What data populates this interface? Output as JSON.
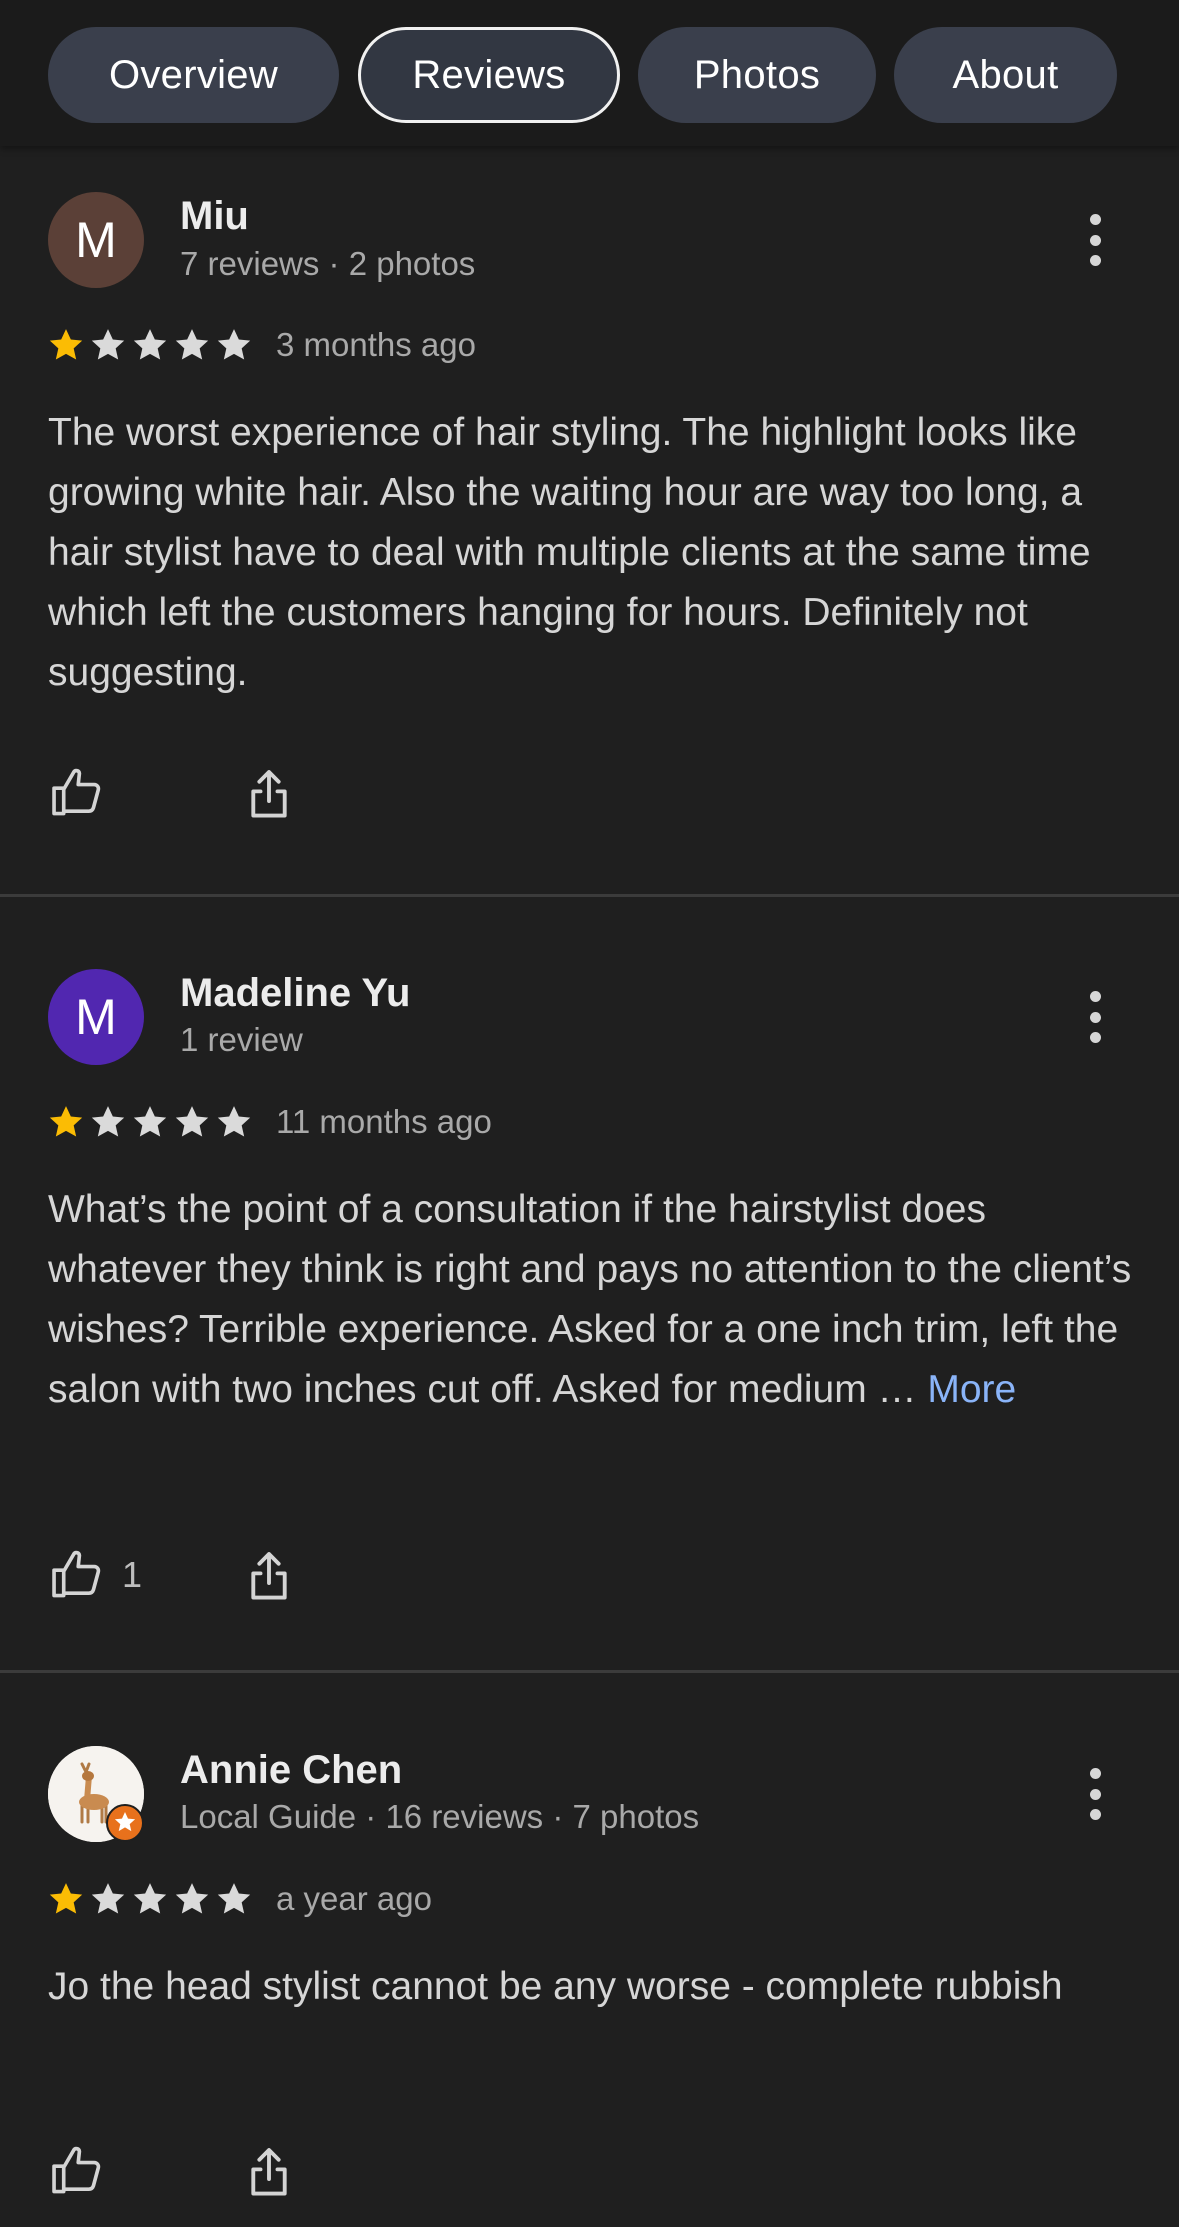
{
  "tabs": [
    {
      "label": "Overview",
      "active": false
    },
    {
      "label": "Reviews",
      "active": true
    },
    {
      "label": "Photos",
      "active": false
    },
    {
      "label": "About",
      "active": false
    }
  ],
  "colors": {
    "star_filled": "#fbbc04",
    "star_empty": "#dadada",
    "link": "#8ab4f8",
    "avatar_miu": "#5b4037",
    "avatar_madeline": "#5127b0",
    "local_guide_badge": "#e8711c"
  },
  "reviews": [
    {
      "avatar_letter": "M",
      "name": "Miu",
      "meta": "7 reviews · 2 photos",
      "rating": 1,
      "max_rating": 5,
      "time": "3 months ago",
      "text": "The worst experience of hair styling. The highlight looks like growing white hair. Also the waiting hour are way too long, a hair stylist have to deal with multiple clients at the same time which left the customers hanging for hours. Definitely not suggesting.",
      "more": "",
      "likes": ""
    },
    {
      "avatar_letter": "M",
      "name": "Madeline Yu",
      "meta": "1 review",
      "rating": 1,
      "max_rating": 5,
      "time": "11 months ago",
      "text": "What’s the point of a consultation if the hairstylist does whatever they think is right and pays no attention to the client’s wishes? Terrible experience. Asked for a one inch trim, left the salon with two inches cut off. Asked for medium …",
      "more": "More",
      "likes": "1"
    },
    {
      "avatar_letter": "",
      "name": "Annie Chen",
      "meta": "Local Guide · 16 reviews · 7 photos",
      "rating": 1,
      "max_rating": 5,
      "time": "a year ago",
      "text": "Jo the head stylist cannot be any worse - complete rubbish",
      "more": "",
      "likes": ""
    }
  ],
  "icons": {
    "like": "thumb-up-icon",
    "share": "share-icon",
    "more": "more-vert-icon",
    "badge": "local-guide-star-icon",
    "avatar_photo": "deer-photo-icon"
  }
}
